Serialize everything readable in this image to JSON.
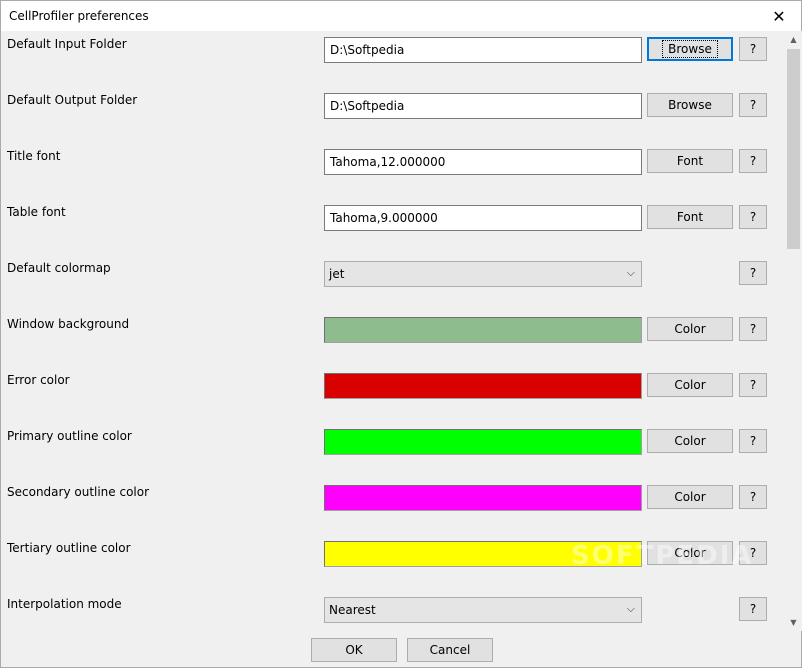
{
  "window": {
    "title": "CellProfiler preferences",
    "close_glyph": "✕"
  },
  "rows": [
    {
      "label": "Default Input Folder",
      "kind": "text",
      "value": "D:\\Softpedia",
      "button": "Browse",
      "help": "?"
    },
    {
      "label": "Default Output Folder",
      "kind": "text",
      "value": "D:\\Softpedia",
      "button": "Browse",
      "help": "?"
    },
    {
      "label": "Title font",
      "kind": "text",
      "value": "Tahoma,12.000000",
      "button": "Font",
      "help": "?"
    },
    {
      "label": "Table font",
      "kind": "text",
      "value": "Tahoma,9.000000",
      "button": "Font",
      "help": "?"
    },
    {
      "label": "Default colormap",
      "kind": "select",
      "value": "jet",
      "help": "?"
    },
    {
      "label": "Window background",
      "kind": "color",
      "color": "#8fbc8f",
      "button": "Color",
      "help": "?"
    },
    {
      "label": "Error color",
      "kind": "color",
      "color": "#d90000",
      "button": "Color",
      "help": "?"
    },
    {
      "label": "Primary outline color",
      "kind": "color",
      "color": "#00ff00",
      "button": "Color",
      "help": "?"
    },
    {
      "label": "Secondary outline color",
      "kind": "color",
      "color": "#ff00ff",
      "button": "Color",
      "help": "?"
    },
    {
      "label": "Tertiary outline color",
      "kind": "color",
      "color": "#ffff00",
      "button": "Color",
      "help": "?"
    },
    {
      "label": "Interpolation mode",
      "kind": "select",
      "value": "Nearest",
      "help": "?"
    }
  ],
  "footer": {
    "ok_label": "OK",
    "cancel_label": "Cancel"
  },
  "watermark": "SOFTPEDIA",
  "icons": {
    "chevron": "⌵",
    "scroll_up": "▲",
    "scroll_down": "▼"
  }
}
